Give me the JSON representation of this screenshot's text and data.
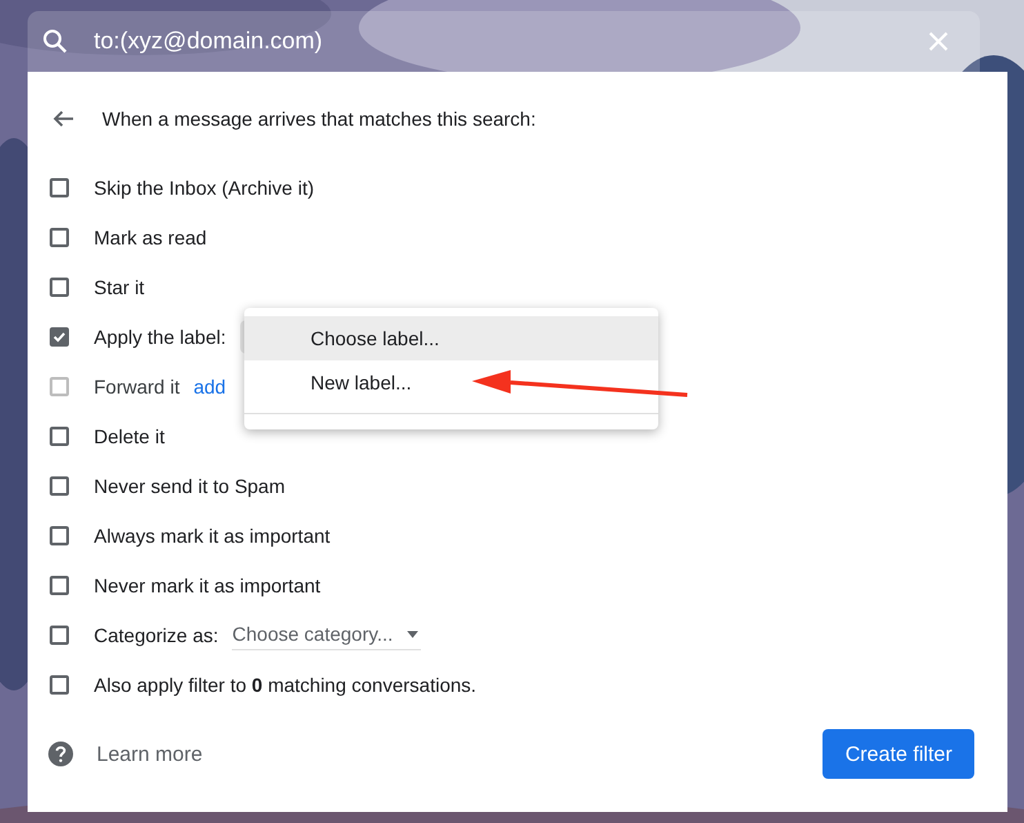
{
  "search": {
    "value": "to:(xyz@domain.com)"
  },
  "header": "When a message arrives that matches this search:",
  "options": [
    {
      "kind": "plain",
      "label": "Skip the Inbox (Archive it)",
      "checked": false,
      "disabled": false
    },
    {
      "kind": "plain",
      "label": "Mark as read",
      "checked": false,
      "disabled": false
    },
    {
      "kind": "plain",
      "label": "Star it",
      "checked": false,
      "disabled": false
    },
    {
      "kind": "label_select",
      "label": "Apply the label:",
      "checked": true,
      "disabled": false
    },
    {
      "kind": "forward",
      "label": "Forward it",
      "link": "add",
      "checked": false,
      "disabled": true
    },
    {
      "kind": "plain",
      "label": "Delete it",
      "checked": false,
      "disabled": false
    },
    {
      "kind": "plain",
      "label": "Never send it to Spam",
      "checked": false,
      "disabled": false
    },
    {
      "kind": "plain",
      "label": "Always mark it as important",
      "checked": false,
      "disabled": false
    },
    {
      "kind": "plain",
      "label": "Never mark it as important",
      "checked": false,
      "disabled": false
    },
    {
      "kind": "category_select",
      "label": "Categorize as:",
      "select": "Choose category...",
      "checked": false,
      "disabled": false
    },
    {
      "kind": "plain",
      "label": "Also apply filter to **0** matching conversations.",
      "checked": false,
      "disabled": false
    }
  ],
  "label_menu": [
    {
      "label": "Choose label...",
      "selected": true
    },
    {
      "label": "New label...",
      "selected": false
    }
  ],
  "learn_more": "Learn more",
  "create_button": "Create filter"
}
